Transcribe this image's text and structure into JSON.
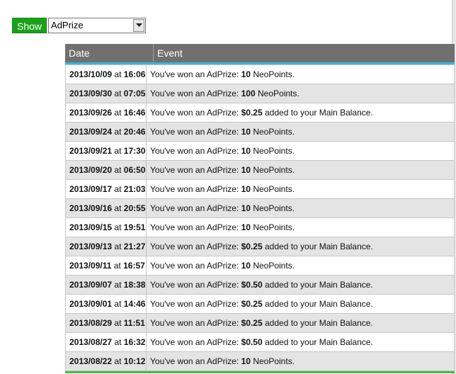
{
  "filter": {
    "show_label": "Show",
    "selected": "AdPrize"
  },
  "table": {
    "headers": [
      "Date",
      "Event"
    ],
    "at_word": "at",
    "rows": [
      {
        "date": "2013/10/09",
        "time": "16:06",
        "prefix": "You've won an AdPrize:",
        "amount": "10",
        "suffix": "NeoPoints."
      },
      {
        "date": "2013/09/30",
        "time": "07:05",
        "prefix": "You've won an AdPrize:",
        "amount": "100",
        "suffix": "NeoPoints."
      },
      {
        "date": "2013/09/26",
        "time": "16:46",
        "prefix": "You've won an AdPrize:",
        "amount": "$0.25",
        "suffix": "added to your Main Balance."
      },
      {
        "date": "2013/09/24",
        "time": "20:46",
        "prefix": "You've won an AdPrize:",
        "amount": "10",
        "suffix": "NeoPoints."
      },
      {
        "date": "2013/09/21",
        "time": "17:30",
        "prefix": "You've won an AdPrize:",
        "amount": "10",
        "suffix": "NeoPoints."
      },
      {
        "date": "2013/09/20",
        "time": "06:50",
        "prefix": "You've won an AdPrize:",
        "amount": "10",
        "suffix": "NeoPoints."
      },
      {
        "date": "2013/09/17",
        "time": "21:03",
        "prefix": "You've won an AdPrize:",
        "amount": "10",
        "suffix": "NeoPoints."
      },
      {
        "date": "2013/09/16",
        "time": "20:55",
        "prefix": "You've won an AdPrize:",
        "amount": "10",
        "suffix": "NeoPoints."
      },
      {
        "date": "2013/09/15",
        "time": "19:51",
        "prefix": "You've won an AdPrize:",
        "amount": "10",
        "suffix": "NeoPoints."
      },
      {
        "date": "2013/09/13",
        "time": "21:27",
        "prefix": "You've won an AdPrize:",
        "amount": "$0.25",
        "suffix": "added to your Main Balance."
      },
      {
        "date": "2013/09/11",
        "time": "16:57",
        "prefix": "You've won an AdPrize:",
        "amount": "10",
        "suffix": "NeoPoints."
      },
      {
        "date": "2013/09/07",
        "time": "18:38",
        "prefix": "You've won an AdPrize:",
        "amount": "$0.50",
        "suffix": "added to your Main Balance."
      },
      {
        "date": "2013/09/01",
        "time": "14:46",
        "prefix": "You've won an AdPrize:",
        "amount": "$0.25",
        "suffix": "added to your Main Balance."
      },
      {
        "date": "2013/08/29",
        "time": "11:51",
        "prefix": "You've won an AdPrize:",
        "amount": "$0.25",
        "suffix": "added to your Main Balance."
      },
      {
        "date": "2013/08/27",
        "time": "16:32",
        "prefix": "You've won an AdPrize:",
        "amount": "$0.50",
        "suffix": "added to your Main Balance."
      },
      {
        "date": "2013/08/22",
        "time": "10:12",
        "prefix": "You've won an AdPrize:",
        "amount": "10",
        "suffix": "NeoPoints."
      }
    ]
  },
  "colors": {
    "show_button": "#1aa11a",
    "header_bg": "#707070",
    "header_accent": "#39b3e0",
    "footer_accent": "#4cb848"
  },
  "icons": {
    "dropdown": "chevron-down-icon"
  }
}
